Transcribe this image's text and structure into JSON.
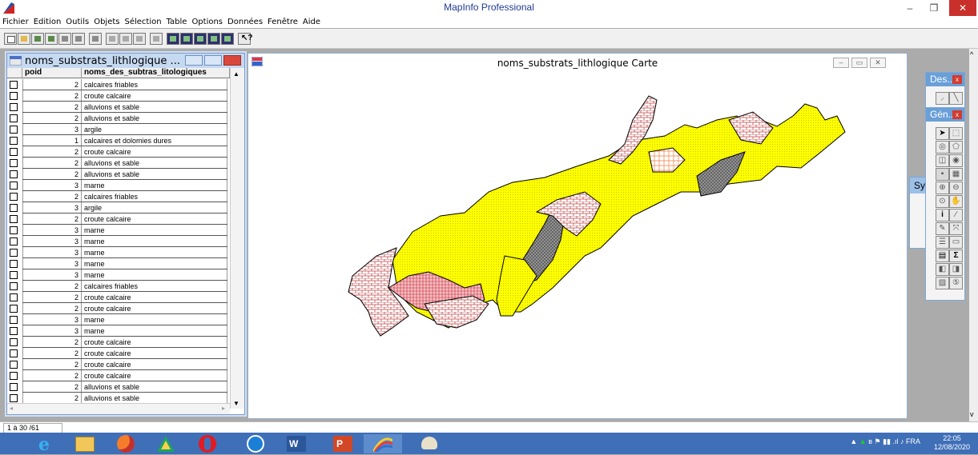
{
  "app": {
    "title": "MapInfo Professional"
  },
  "window_controls": {
    "minimize": "–",
    "restore": "❐",
    "close": "✕"
  },
  "menu": [
    "Fichier",
    "Edition",
    "Outils",
    "Objets",
    "Sélection",
    "Table",
    "Options",
    "Données",
    "Fenêtre",
    "Aide"
  ],
  "browser": {
    "title": "noms_substrats_lithlogique ...",
    "columns": [
      "poid",
      "noms_des_subtras_litologiques"
    ],
    "rows": [
      {
        "poid": "2",
        "name": "calcaires friables"
      },
      {
        "poid": "2",
        "name": "croute calcaire"
      },
      {
        "poid": "2",
        "name": "alluvions et sable"
      },
      {
        "poid": "2",
        "name": "alluvions et sable"
      },
      {
        "poid": "3",
        "name": "argile"
      },
      {
        "poid": "1",
        "name": "calcaires et dolomies dures"
      },
      {
        "poid": "2",
        "name": "croute calcaire"
      },
      {
        "poid": "2",
        "name": "alluvions et sable"
      },
      {
        "poid": "2",
        "name": "alluvions et sable"
      },
      {
        "poid": "3",
        "name": "marne"
      },
      {
        "poid": "2",
        "name": "calcaires friables"
      },
      {
        "poid": "3",
        "name": "argile"
      },
      {
        "poid": "2",
        "name": "croute calcaire"
      },
      {
        "poid": "3",
        "name": "marne"
      },
      {
        "poid": "3",
        "name": "marne"
      },
      {
        "poid": "3",
        "name": "marne"
      },
      {
        "poid": "3",
        "name": "marne"
      },
      {
        "poid": "3",
        "name": "marne"
      },
      {
        "poid": "2",
        "name": "calcaires friables"
      },
      {
        "poid": "2",
        "name": "croute calcaire"
      },
      {
        "poid": "2",
        "name": "croute calcaire"
      },
      {
        "poid": "3",
        "name": "marne"
      },
      {
        "poid": "3",
        "name": "marne"
      },
      {
        "poid": "2",
        "name": "croute calcaire"
      },
      {
        "poid": "2",
        "name": "croute calcaire"
      },
      {
        "poid": "2",
        "name": "croute calcaire"
      },
      {
        "poid": "2",
        "name": "croute calcaire"
      },
      {
        "poid": "2",
        "name": "alluvions et sable"
      },
      {
        "poid": "2",
        "name": "alluvions et sable"
      }
    ]
  },
  "map": {
    "title": "noms_substrats_lithlogique Carte",
    "colors": {
      "yellow": "#ffff00",
      "gray": "#8a8a8a",
      "pink": "#f3b1b5",
      "orange": "#f9c9a0",
      "outline": "#000000"
    }
  },
  "palettes": {
    "dessin": {
      "title": "Des..."
    },
    "general": {
      "title": "Gén..."
    },
    "symbols": {
      "title": "Sy"
    }
  },
  "status": {
    "records": "1 à 30 /61"
  },
  "taskbar": {
    "language": "FRA",
    "time": "22:05",
    "date": "12/08/2020"
  }
}
